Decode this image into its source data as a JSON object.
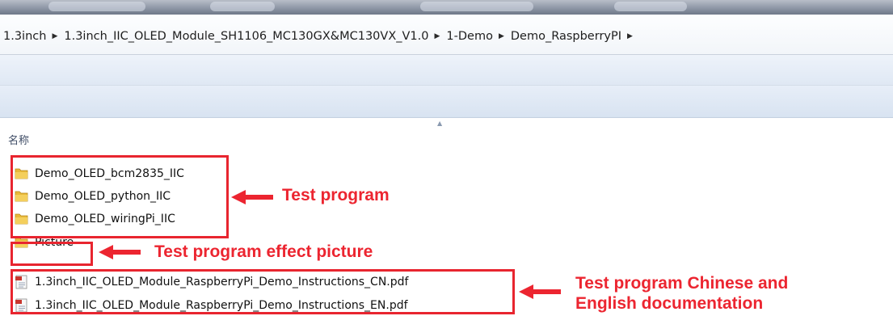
{
  "breadcrumb": {
    "items": [
      "1.3inch",
      "1.3inch_IIC_OLED_Module_SH1106_MC130GX&MC130VX_V1.0",
      "1-Demo",
      "Demo_RaspberryPI"
    ],
    "separator": "▶"
  },
  "file_list": {
    "column_header": "名称",
    "files": [
      {
        "name": "Demo_OLED_bcm2835_IIC",
        "type": "folder",
        "icon": "folder-icon"
      },
      {
        "name": "Demo_OLED_python_IIC",
        "type": "folder",
        "icon": "folder-icon"
      },
      {
        "name": "Demo_OLED_wiringPi_IIC",
        "type": "folder",
        "icon": "folder-icon"
      },
      {
        "name": "Picture",
        "type": "folder",
        "icon": "folder-icon"
      },
      {
        "name": "1.3inch_IIC_OLED_Module_RaspberryPi_Demo_Instructions_CN.pdf",
        "type": "pdf",
        "icon": "pdf-icon"
      },
      {
        "name": "1.3inch_IIC_OLED_Module_RaspberryPi_Demo_Instructions_EN.pdf",
        "type": "pdf",
        "icon": "pdf-icon"
      }
    ]
  },
  "annotations": {
    "test_program": "Test program",
    "effect_picture": "Test program effect picture",
    "documentation_line1": "Test program Chinese and",
    "documentation_line2": "English documentation"
  },
  "colors": {
    "annotation_red": "#ec2530",
    "folder_yellow": "#e8b93a",
    "header_text": "#3d4b64"
  }
}
